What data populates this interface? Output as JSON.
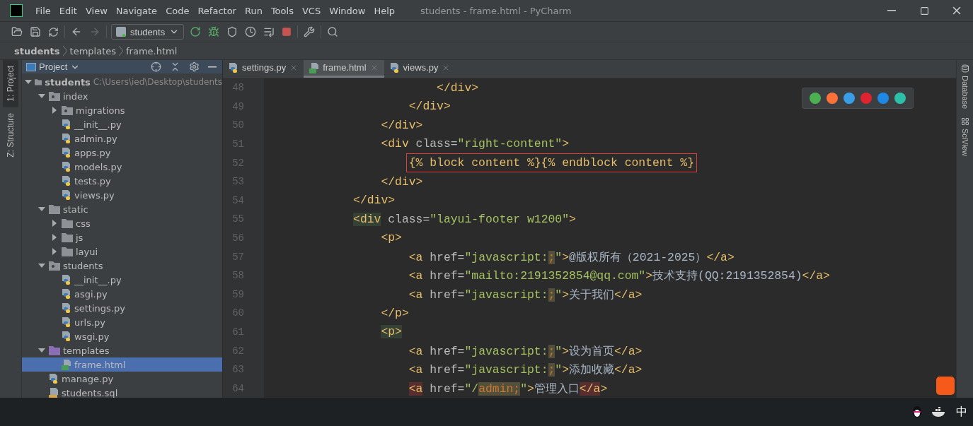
{
  "window": {
    "title": "students - frame.html - PyCharm"
  },
  "menu": [
    "File",
    "Edit",
    "View",
    "Navigate",
    "Code",
    "Refactor",
    "Run",
    "Tools",
    "VCS",
    "Window",
    "Help"
  ],
  "toolbar": {
    "run_config": "students"
  },
  "breadcrumbs": [
    "students",
    "templates",
    "frame.html"
  ],
  "left_stripe": [
    "1: Project",
    "Z: Structure"
  ],
  "right_stripe": [
    "Database",
    "SciView"
  ],
  "project_panel": {
    "title": "Project"
  },
  "tree": {
    "label": "students",
    "path": "C:\\Users\\ied\\Desktop\\students",
    "kind": "folder",
    "expanded": true,
    "selected": false,
    "children": [
      {
        "label": "index",
        "kind": "package",
        "expanded": true,
        "selected": false,
        "children": [
          {
            "label": "migrations",
            "kind": "package",
            "expanded": false,
            "selected": false
          },
          {
            "label": "__init__.py",
            "kind": "python",
            "selected": false
          },
          {
            "label": "admin.py",
            "kind": "python",
            "selected": false
          },
          {
            "label": "apps.py",
            "kind": "python",
            "selected": false
          },
          {
            "label": "models.py",
            "kind": "python",
            "selected": false
          },
          {
            "label": "tests.py",
            "kind": "python",
            "selected": false
          },
          {
            "label": "views.py",
            "kind": "python",
            "selected": false
          }
        ]
      },
      {
        "label": "static",
        "kind": "folder",
        "expanded": true,
        "selected": false,
        "children": [
          {
            "label": "css",
            "kind": "folder",
            "expanded": false,
            "selected": false
          },
          {
            "label": "js",
            "kind": "folder",
            "expanded": false,
            "selected": false
          },
          {
            "label": "layui",
            "kind": "folder",
            "expanded": false,
            "selected": false
          }
        ]
      },
      {
        "label": "students",
        "kind": "package",
        "expanded": true,
        "selected": false,
        "children": [
          {
            "label": "__init__.py",
            "kind": "python",
            "selected": false
          },
          {
            "label": "asgi.py",
            "kind": "python",
            "selected": false
          },
          {
            "label": "settings.py",
            "kind": "python",
            "selected": false
          },
          {
            "label": "urls.py",
            "kind": "python",
            "selected": false
          },
          {
            "label": "wsgi.py",
            "kind": "python",
            "selected": false
          }
        ]
      },
      {
        "label": "templates",
        "kind": "templates",
        "expanded": true,
        "selected": false,
        "children": [
          {
            "label": "frame.html",
            "kind": "html",
            "selected": true
          }
        ]
      },
      {
        "label": "manage.py",
        "kind": "python",
        "selected": false
      },
      {
        "label": "students.sql",
        "kind": "sql",
        "selected": false
      }
    ]
  },
  "tabs": [
    {
      "label": "settings.py",
      "kind": "python",
      "selected": false
    },
    {
      "label": "frame.html",
      "kind": "html",
      "selected": true
    },
    {
      "label": "views.py",
      "kind": "python",
      "selected": false
    }
  ],
  "code_lines": [
    {
      "number": "48",
      "boxed": false,
      "segments": [
        {
          "kind": "tag",
          "text": "                        </div>"
        }
      ]
    },
    {
      "number": "49",
      "boxed": false,
      "segments": [
        {
          "kind": "tag",
          "text": "                    </div>"
        }
      ]
    },
    {
      "number": "50",
      "boxed": false,
      "segments": [
        {
          "kind": "tag",
          "text": "                </div>"
        }
      ]
    },
    {
      "number": "51",
      "boxed": false,
      "segments": [
        {
          "kind": "tag",
          "text": "                <div"
        },
        {
          "kind": "attr",
          "text": " class="
        },
        {
          "kind": "string",
          "text": "\"right-content\""
        },
        {
          "kind": "tag",
          "text": ">"
        }
      ]
    },
    {
      "number": "52",
      "boxed": true,
      "segments": [
        {
          "kind": "template",
          "text": "                    {% block content %}{% endblock content %}"
        }
      ]
    },
    {
      "number": "53",
      "boxed": false,
      "segments": [
        {
          "kind": "tag",
          "text": "                </div>"
        }
      ]
    },
    {
      "number": "54",
      "boxed": false,
      "segments": [
        {
          "kind": "tag",
          "text": "            </div>"
        }
      ]
    },
    {
      "number": "55",
      "boxed": false,
      "segments": [
        {
          "kind": "match",
          "text": "            <div"
        },
        {
          "kind": "attr",
          "text": " class="
        },
        {
          "kind": "string",
          "text": "\"layui-footer w1200\""
        },
        {
          "kind": "tag",
          "text": ">"
        }
      ]
    },
    {
      "number": "56",
      "boxed": false,
      "segments": [
        {
          "kind": "tag",
          "text": "                <p>"
        }
      ]
    },
    {
      "number": "57",
      "boxed": false,
      "segments": [
        {
          "kind": "tag",
          "text": "                    <a"
        },
        {
          "kind": "attr",
          "text": " href="
        },
        {
          "kind": "string",
          "text": "\"javascript:"
        },
        {
          "kind": "warn",
          "text": ";"
        },
        {
          "kind": "string",
          "text": "\""
        },
        {
          "kind": "tag",
          "text": ">"
        },
        {
          "kind": "text",
          "text": "@版权所有（2021-2025）"
        },
        {
          "kind": "tag",
          "text": "</a>"
        }
      ]
    },
    {
      "number": "58",
      "boxed": false,
      "segments": [
        {
          "kind": "tag",
          "text": "                    <a"
        },
        {
          "kind": "attr",
          "text": " href="
        },
        {
          "kind": "string",
          "text": "\"mailto:2191352854@qq.com\""
        },
        {
          "kind": "tag",
          "text": ">"
        },
        {
          "kind": "text",
          "text": "技术支持(QQ:2191352854)"
        },
        {
          "kind": "tag",
          "text": "</a>"
        }
      ]
    },
    {
      "number": "59",
      "boxed": false,
      "segments": [
        {
          "kind": "tag",
          "text": "                    <a"
        },
        {
          "kind": "attr",
          "text": " href="
        },
        {
          "kind": "string",
          "text": "\"javascript:"
        },
        {
          "kind": "warn",
          "text": ";"
        },
        {
          "kind": "string",
          "text": "\""
        },
        {
          "kind": "tag",
          "text": ">"
        },
        {
          "kind": "text",
          "text": "关于我们"
        },
        {
          "kind": "tag",
          "text": "</a>"
        }
      ]
    },
    {
      "number": "60",
      "boxed": false,
      "segments": [
        {
          "kind": "tag",
          "text": "                </p>"
        }
      ]
    },
    {
      "number": "61",
      "boxed": false,
      "segments": [
        {
          "kind": "match",
          "text": "                <p>"
        }
      ]
    },
    {
      "number": "62",
      "boxed": false,
      "segments": [
        {
          "kind": "tag",
          "text": "                    <a"
        },
        {
          "kind": "attr",
          "text": " href="
        },
        {
          "kind": "string",
          "text": "\"javascript:"
        },
        {
          "kind": "warn",
          "text": ";"
        },
        {
          "kind": "string",
          "text": "\""
        },
        {
          "kind": "tag",
          "text": ">"
        },
        {
          "kind": "text",
          "text": "设为首页"
        },
        {
          "kind": "tag",
          "text": "</a>"
        }
      ]
    },
    {
      "number": "63",
      "boxed": false,
      "segments": [
        {
          "kind": "tag",
          "text": "                    <a"
        },
        {
          "kind": "attr",
          "text": " href="
        },
        {
          "kind": "string",
          "text": "\"javascript:"
        },
        {
          "kind": "warn",
          "text": ";"
        },
        {
          "kind": "string",
          "text": "\""
        },
        {
          "kind": "tag",
          "text": ">"
        },
        {
          "kind": "text",
          "text": "添加收藏"
        },
        {
          "kind": "tag",
          "text": "</a>"
        }
      ]
    },
    {
      "number": "64",
      "boxed": false,
      "segments": [
        {
          "kind": "error",
          "text": "                    <a"
        },
        {
          "kind": "attr",
          "text": " href="
        },
        {
          "kind": "string",
          "text": "\"/"
        },
        {
          "kind": "warn",
          "text": "admin;"
        },
        {
          "kind": "string",
          "text": "\""
        },
        {
          "kind": "tag",
          "text": ">"
        },
        {
          "kind": "text",
          "text": "管理入口"
        },
        {
          "kind": "error",
          "text": "</a"
        },
        {
          "kind": "tag",
          "text": ">"
        }
      ]
    }
  ],
  "browser_popup": [
    {
      "color": "#4caf50"
    },
    {
      "color": "#ff7139"
    },
    {
      "color": "#3a9ee6"
    },
    {
      "color": "#e0242f"
    },
    {
      "color": "#1e88e5"
    },
    {
      "color": "#2cc0a8"
    }
  ],
  "taskbar": {
    "ime": "中"
  }
}
